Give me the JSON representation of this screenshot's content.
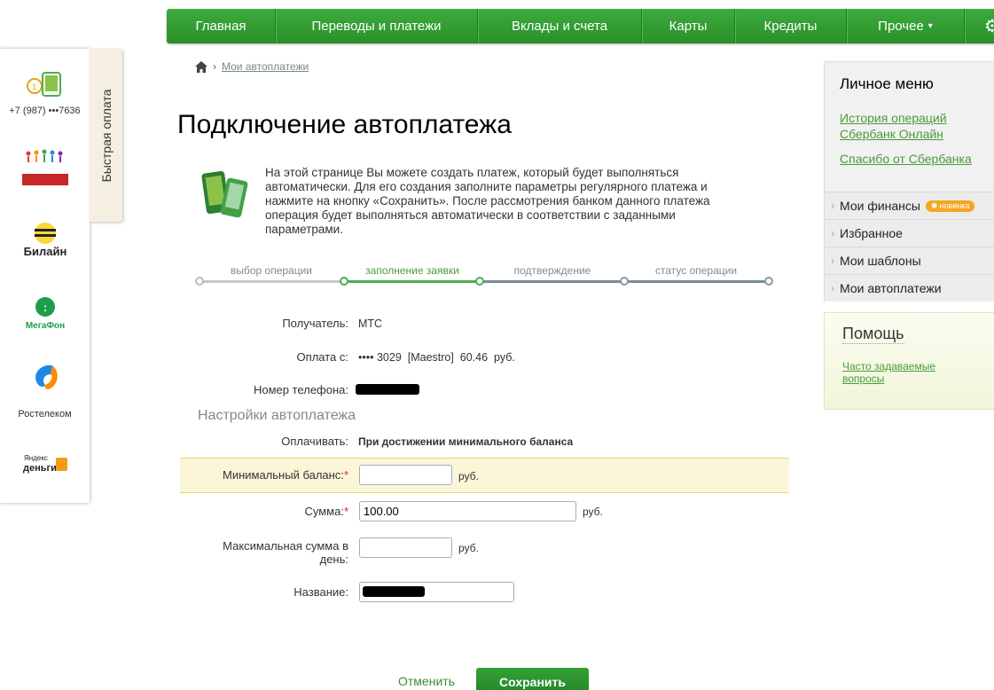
{
  "nav": {
    "items": [
      "Главная",
      "Переводы и платежи",
      "Вклады и счета",
      "Карты",
      "Кредиты",
      "Прочее"
    ],
    "settings_icon": "gear-icon"
  },
  "quickpay": {
    "tab_label": "Быстрая оплата",
    "phone": "+7 (987) •••7636",
    "items": [
      {
        "name": "Детский благотворительный фонд",
        "icon": "charity-icon"
      },
      {
        "name": "Билайн",
        "icon": "beeline-logo"
      },
      {
        "name": "МегаФон",
        "icon": "megafon-logo"
      },
      {
        "name": "Ростелеком",
        "icon": "rostelecom-logo"
      },
      {
        "name": "Яндекс деньги",
        "icon": "yandex-money-logo"
      }
    ],
    "logo_texts": {
      "beeline": "Билайн",
      "megafon": "МегаФон",
      "rostelecom": "Ростелеком",
      "yandex_top": "Яндекс",
      "yandex_bottom": "деньги"
    }
  },
  "breadcrumb": {
    "link": "Мои автоплатежи"
  },
  "page": {
    "title": "Подключение автоплатежа",
    "intro": "На этой странице Вы можете создать платеж, который будет выполняться автоматически. Для его создания заполните параметры регулярного платежа и нажмите на кнопку «Сохранить». После рассмотрения банком данного платежа операция будет выполняться автоматически в соответствии с заданными параметрами."
  },
  "stepper": {
    "steps": [
      "выбор операции",
      "заполнение заявки",
      "подтверждение",
      "статус операции"
    ],
    "current_index": 1
  },
  "form": {
    "recipient_label": "Получатель:",
    "recipient_value": "МТС",
    "payfrom_label": "Оплата с:",
    "payfrom_value": "•••• 3029  [Maestro]  60.46  руб.",
    "phone_label": "Номер телефона:",
    "settings_title": "Настройки автоплатежа",
    "pay_label": "Оплачивать:",
    "pay_value": "При достижении минимального баланса",
    "min_balance_label": "Минимальный баланс:",
    "min_balance_value": "",
    "amount_label": "Сумма:",
    "amount_value": "100.00",
    "max_day_label_1": "Максимальная сумма в",
    "max_day_label_2": "день:",
    "max_day_value": "",
    "name_label": "Название:",
    "unit": "руб.",
    "required_mark": "*"
  },
  "actions": {
    "cancel": "Отменить",
    "save": "Сохранить"
  },
  "personal_menu": {
    "title": "Личное меню",
    "links": [
      "История операций Сбербанк Онлайн",
      "Спасибо от Сбербанка"
    ],
    "items": [
      "Мои финансы",
      "Избранное",
      "Мои шаблоны",
      "Мои автоплатежи"
    ],
    "new_badge": "новинка"
  },
  "help": {
    "title": "Помощь",
    "faq": "Часто задаваемые вопросы"
  },
  "colors": {
    "brand_green": "#2e9b2e",
    "link_green": "#4a9a3a",
    "highlight": "#fbf6d8"
  }
}
